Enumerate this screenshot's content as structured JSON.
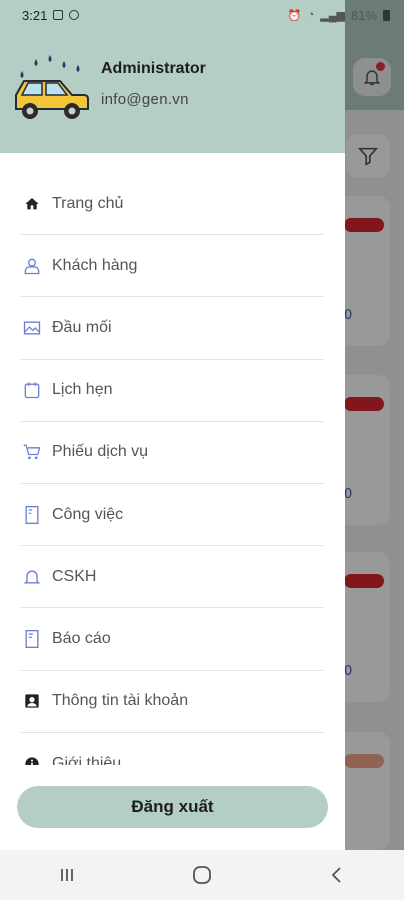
{
  "status_bar": {
    "time": "3:21",
    "battery": "81%"
  },
  "background_app": {
    "card_counts": [
      "0",
      "0",
      "0"
    ],
    "accent_red": "#d7262f"
  },
  "drawer": {
    "user": {
      "name": "Administrator",
      "email": "info@gen.vn"
    },
    "menu": [
      {
        "label": "Trang chủ",
        "icon": "home-icon"
      },
      {
        "label": "Khách hàng",
        "icon": "user-icon"
      },
      {
        "label": "Đầu mối",
        "icon": "image-icon"
      },
      {
        "label": "Lịch hẹn",
        "icon": "calendar-icon"
      },
      {
        "label": "Phiếu dịch vụ",
        "icon": "cart-icon"
      },
      {
        "label": "Công việc",
        "icon": "document-icon"
      },
      {
        "label": "CSKH",
        "icon": "bell-icon"
      },
      {
        "label": "Báo cáo",
        "icon": "report-icon"
      },
      {
        "label": "Thông tin tài khoản",
        "icon": "account-icon"
      },
      {
        "label": "Giới thiệu",
        "icon": "info-icon"
      }
    ],
    "logout_label": "Đăng xuất",
    "header_color": "#b4cdc5"
  },
  "nav_bar": {
    "recent": "recent-apps-icon",
    "home": "home-circle-icon",
    "back": "back-icon"
  }
}
